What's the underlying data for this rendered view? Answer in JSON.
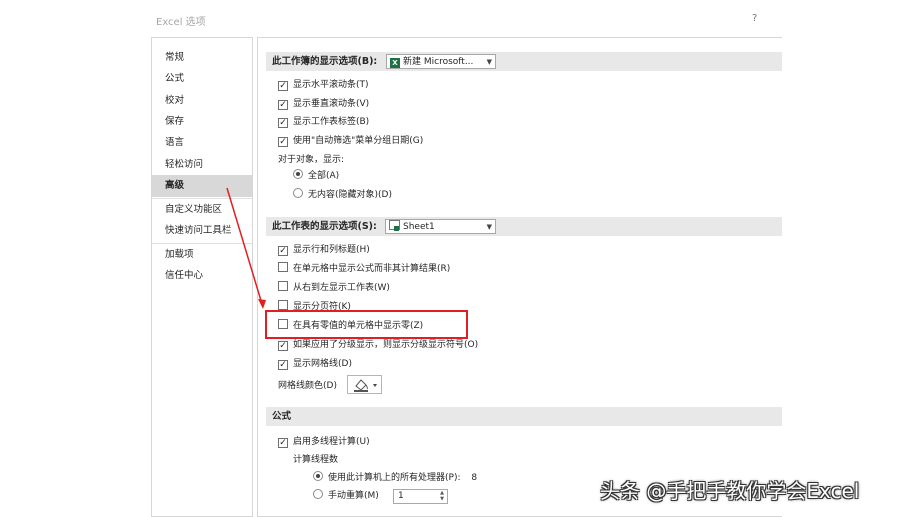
{
  "window": {
    "title": "Excel 选项",
    "help": "?"
  },
  "sidebar": {
    "items": [
      {
        "label": "常规"
      },
      {
        "label": "公式"
      },
      {
        "label": "校对"
      },
      {
        "label": "保存"
      },
      {
        "label": "语言"
      },
      {
        "label": "轻松访问"
      },
      {
        "label": "高级"
      },
      {
        "label": "自定义功能区"
      },
      {
        "label": "快速访问工具栏"
      },
      {
        "label": "加载项"
      },
      {
        "label": "信任中心"
      }
    ],
    "selected": "高级"
  },
  "workbook_section": {
    "title": "此工作簿的显示选项(B):",
    "combo_value": "新建 Microsoft...",
    "options": [
      {
        "label": "显示水平滚动条(T)",
        "checked": true
      },
      {
        "label": "显示垂直滚动条(V)",
        "checked": true
      },
      {
        "label": "显示工作表标签(B)",
        "checked": true
      },
      {
        "label": "使用\"自动筛选\"菜单分组日期(G)",
        "checked": true
      }
    ],
    "objects_label": "对于对象，显示:",
    "objects_radios": [
      {
        "label": "全部(A)",
        "selected": true
      },
      {
        "label": "无内容(隐藏对象)(D)",
        "selected": false
      }
    ]
  },
  "worksheet_section": {
    "title": "此工作表的显示选项(S):",
    "combo_value": "Sheet1",
    "options": [
      {
        "label": "显示行和列标题(H)",
        "checked": true
      },
      {
        "label": "在单元格中显示公式而非其计算结果(R)",
        "checked": false
      },
      {
        "label": "从右到左显示工作表(W)",
        "checked": false
      },
      {
        "label": "显示分页符(K)",
        "checked": false
      },
      {
        "label": "在具有零值的单元格中显示零(Z)",
        "checked": false
      },
      {
        "label": "如果应用了分级显示，则显示分级显示符号(O)",
        "checked": true
      },
      {
        "label": "显示网格线(D)",
        "checked": true
      }
    ],
    "gridline_color_label": "网格线颜色(D)"
  },
  "formula_section": {
    "title": "公式",
    "multithread": {
      "label": "启用多线程计算(U)",
      "checked": true
    },
    "threads_label": "计算线程数",
    "thread_radios": [
      {
        "label": "使用此计算机上的所有处理器(P):",
        "value": "8",
        "selected": true
      },
      {
        "label": "手动重算(M)",
        "value": "1",
        "selected": false
      }
    ]
  },
  "colors": {
    "highlight_border": "#e02020",
    "excel_green": "#1e7145",
    "selected_nav": "#d8d8d8"
  },
  "watermark": "头条 @手把手教你学会Excel"
}
